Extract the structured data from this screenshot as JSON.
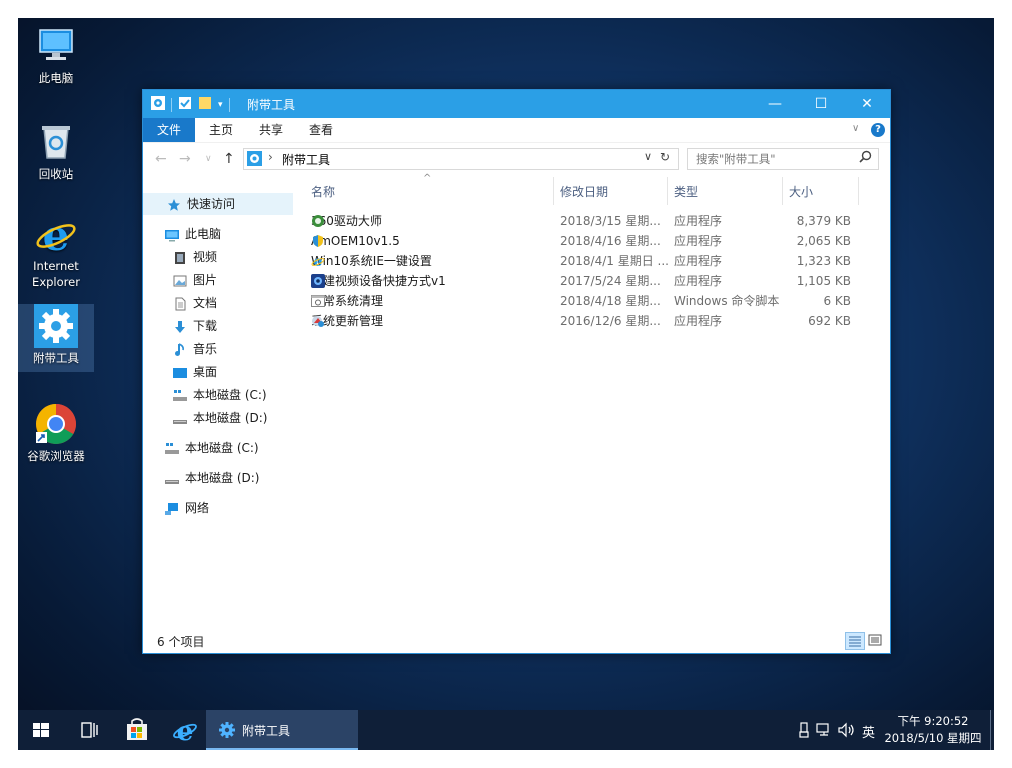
{
  "desktop": {
    "icons": [
      {
        "label": "此电脑"
      },
      {
        "label": "回收站"
      },
      {
        "label": "Internet Explorer"
      },
      {
        "label": "附带工具"
      },
      {
        "label": "谷歌浏览器"
      }
    ]
  },
  "window": {
    "title": "附带工具",
    "controls": {
      "minimize": "—",
      "maximize": "☐",
      "close": "✕"
    }
  },
  "ribbon": {
    "tabs": [
      "文件",
      "主页",
      "共享",
      "查看"
    ]
  },
  "address": {
    "breadcrumb": "附带工具",
    "search_placeholder": "搜索\"附带工具\""
  },
  "sidebar": {
    "quick_access": "快速访问",
    "this_pc": "此电脑",
    "items": [
      "视频",
      "图片",
      "文档",
      "下载",
      "音乐",
      "桌面",
      "本地磁盘 (C:)",
      "本地磁盘 (D:)"
    ],
    "drive_c": "本地磁盘 (C:)",
    "drive_d": "本地磁盘 (D:)",
    "network": "网络"
  },
  "columns": {
    "name": "名称",
    "date": "修改日期",
    "type": "类型",
    "size": "大小"
  },
  "files": [
    {
      "name": "360驱动大师",
      "date": "2018/3/15 星期...",
      "type": "应用程序",
      "size": "8,379 KB"
    },
    {
      "name": "AmOEM10v1.5",
      "date": "2018/4/16 星期...",
      "type": "应用程序",
      "size": "2,065 KB"
    },
    {
      "name": "Win10系统IE一键设置",
      "date": "2018/4/1 星期日 ...",
      "type": "应用程序",
      "size": "1,323 KB"
    },
    {
      "name": "创建视频设备快捷方式v1",
      "date": "2017/5/24 星期...",
      "type": "应用程序",
      "size": "1,105 KB"
    },
    {
      "name": "日常系统清理",
      "date": "2018/4/18 星期...",
      "type": "Windows 命令脚本",
      "size": "6 KB"
    },
    {
      "name": "系统更新管理",
      "date": "2016/12/6 星期...",
      "type": "应用程序",
      "size": "692 KB"
    }
  ],
  "status": {
    "count": "6 个项目"
  },
  "taskbar": {
    "active_window": "附带工具",
    "tray_lang": "英",
    "time": "下午 9:20:52",
    "date": "2018/5/10 星期四"
  },
  "colors": {
    "titlebar": "#2b9fe6",
    "file_tab": "#1979ca",
    "selection": "#cce8ff",
    "taskbar": "#0f1f38"
  }
}
